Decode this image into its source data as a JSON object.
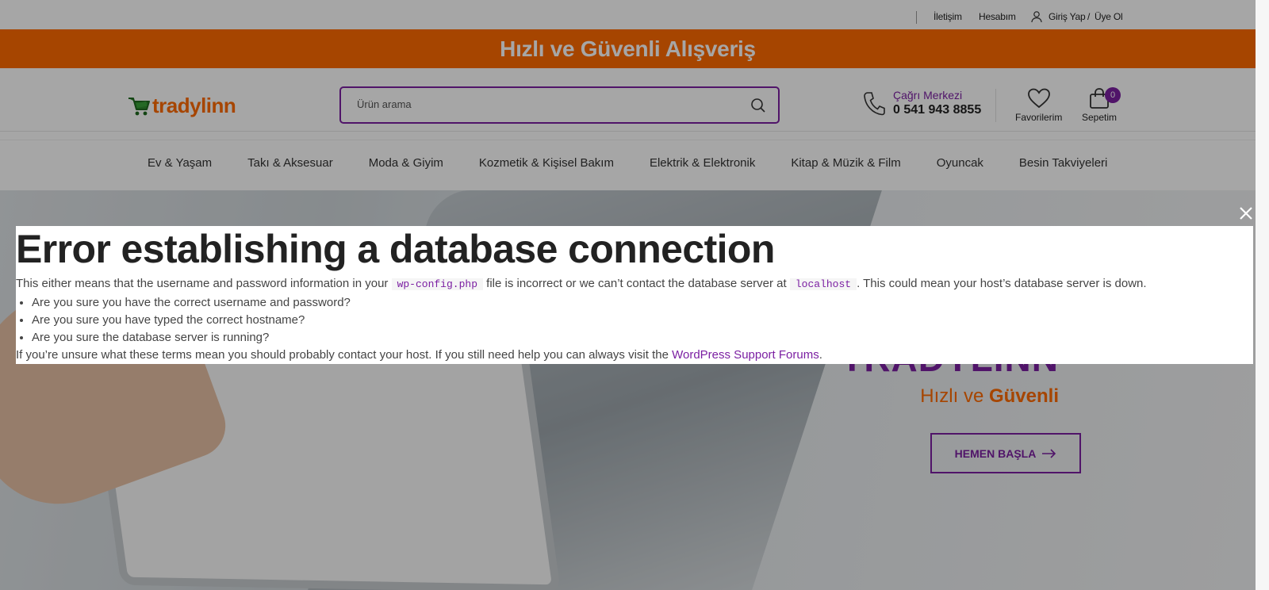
{
  "topbar": {
    "contact": "İletişim",
    "account": "Hesabım",
    "login": "Giriş Yap",
    "sep": "/",
    "register": "Üye Ol"
  },
  "banner": {
    "text": "Hızlı ve Güvenli Alışveriş"
  },
  "header": {
    "brand": "tradylinn",
    "search_placeholder": "Ürün arama",
    "callcenter_label": "Çağrı Merkezi",
    "callcenter_number": "0 541 943 8855",
    "favorites_label": "Favorilerim",
    "cart_label": "Sepetim",
    "cart_count": "0"
  },
  "nav": {
    "items": [
      "Ev & Yaşam",
      "Takı & Aksesuar",
      "Moda & Giyim",
      "Kozmetik & Kişisel Bakım",
      "Elektrik & Elektronik",
      "Kitap & Müzik & Film",
      "Oyuncak",
      "Besin Takviyeleri"
    ]
  },
  "hero": {
    "title": "TRADYLINN",
    "subtitle_plain": "Hızlı ve ",
    "subtitle_bold": "Güvenli",
    "cta": "HEMEN BAŞLA"
  },
  "error": {
    "title": "Error establishing a database connection",
    "para_1": "This either means that the username and password information in your ",
    "code_1": "wp-config.php",
    "para_2": " file is incorrect or we can’t contact the database server at ",
    "code_2": "localhost",
    "para_3": ". This could mean your host’s database server is down.",
    "items": [
      "Are you sure you have the correct username and password?",
      "Are you sure you have typed the correct hostname?",
      "Are you sure the database server is running?"
    ],
    "foot": "If you’re unsure what these terms mean you should probably contact your host. If you still need help you can always visit the ",
    "foot_link": "WordPress Support Forums",
    "foot_end": "."
  },
  "colors": {
    "accent_orange": "#ff6a00",
    "accent_purple": "#7b1fa2"
  }
}
